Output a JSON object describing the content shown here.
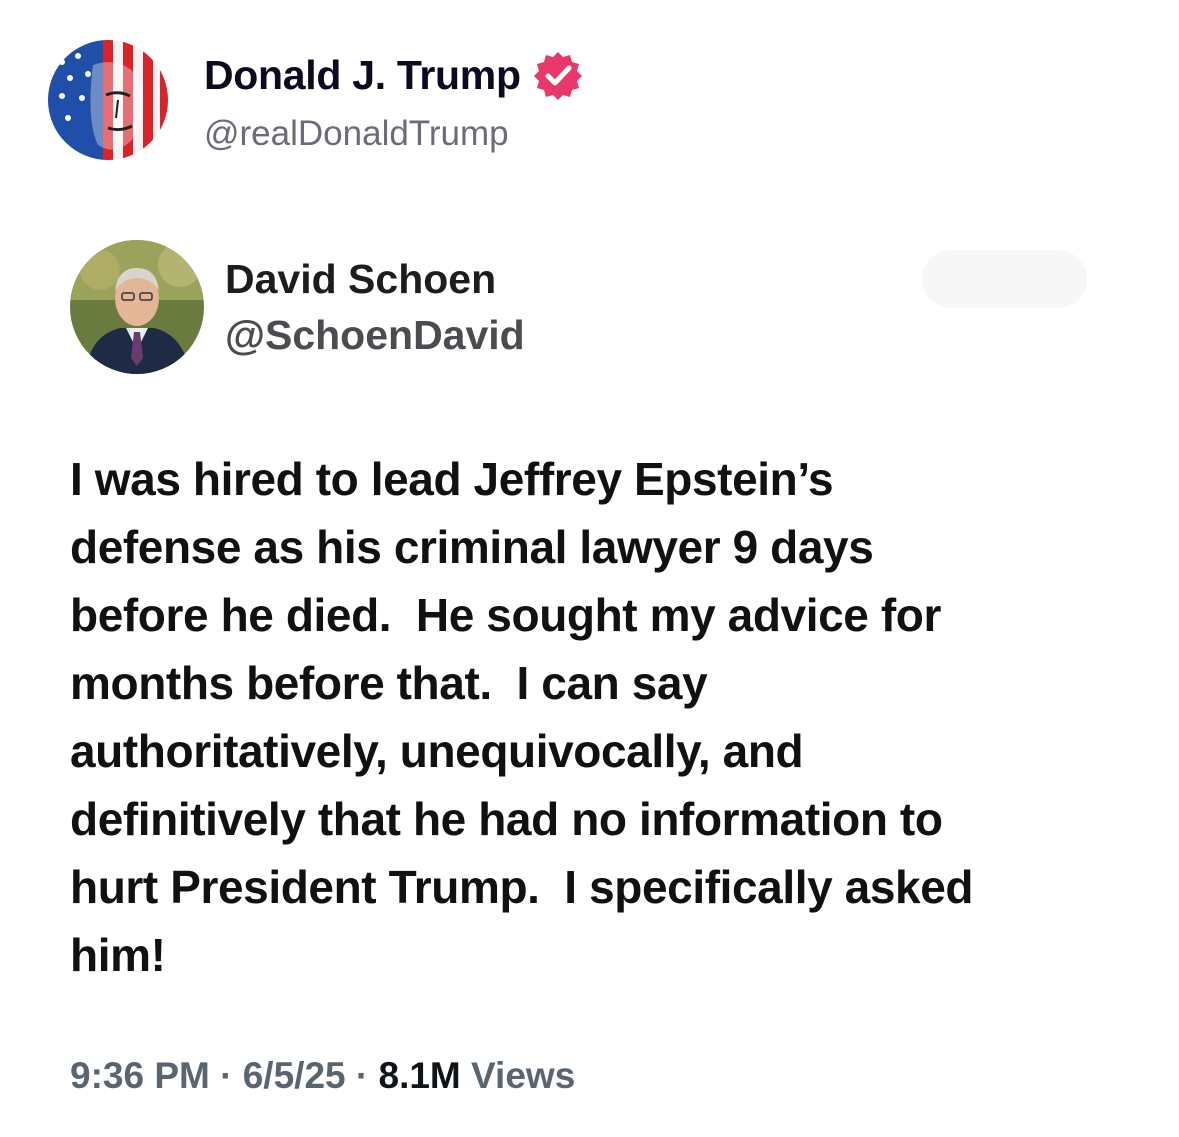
{
  "post_author": {
    "name": "Donald J. Trump",
    "handle": "@realDonaldTrump",
    "verified_badge_color": "#e8386b",
    "avatar_icon": "flag-face-avatar"
  },
  "quoted_post": {
    "author": {
      "name": "David Schoen",
      "handle": "@SchoenDavid",
      "avatar_icon": "portrait-avatar"
    },
    "text_lines": [
      "I was hired to lead Jeffrey Epstein’s",
      "defense as his criminal lawyer 9 days",
      "before he died.  He sought my advice for",
      "months before that.  I can say",
      "authoritatively, unequivocally, and",
      "definitively that he had no information to",
      "hurt President Trump.  I specifically asked",
      "him!"
    ],
    "meta": {
      "time": "9:36 PM",
      "separator": " · ",
      "date": "6/5/25",
      "views_count": "8.1M",
      "views_label": " Views"
    }
  }
}
